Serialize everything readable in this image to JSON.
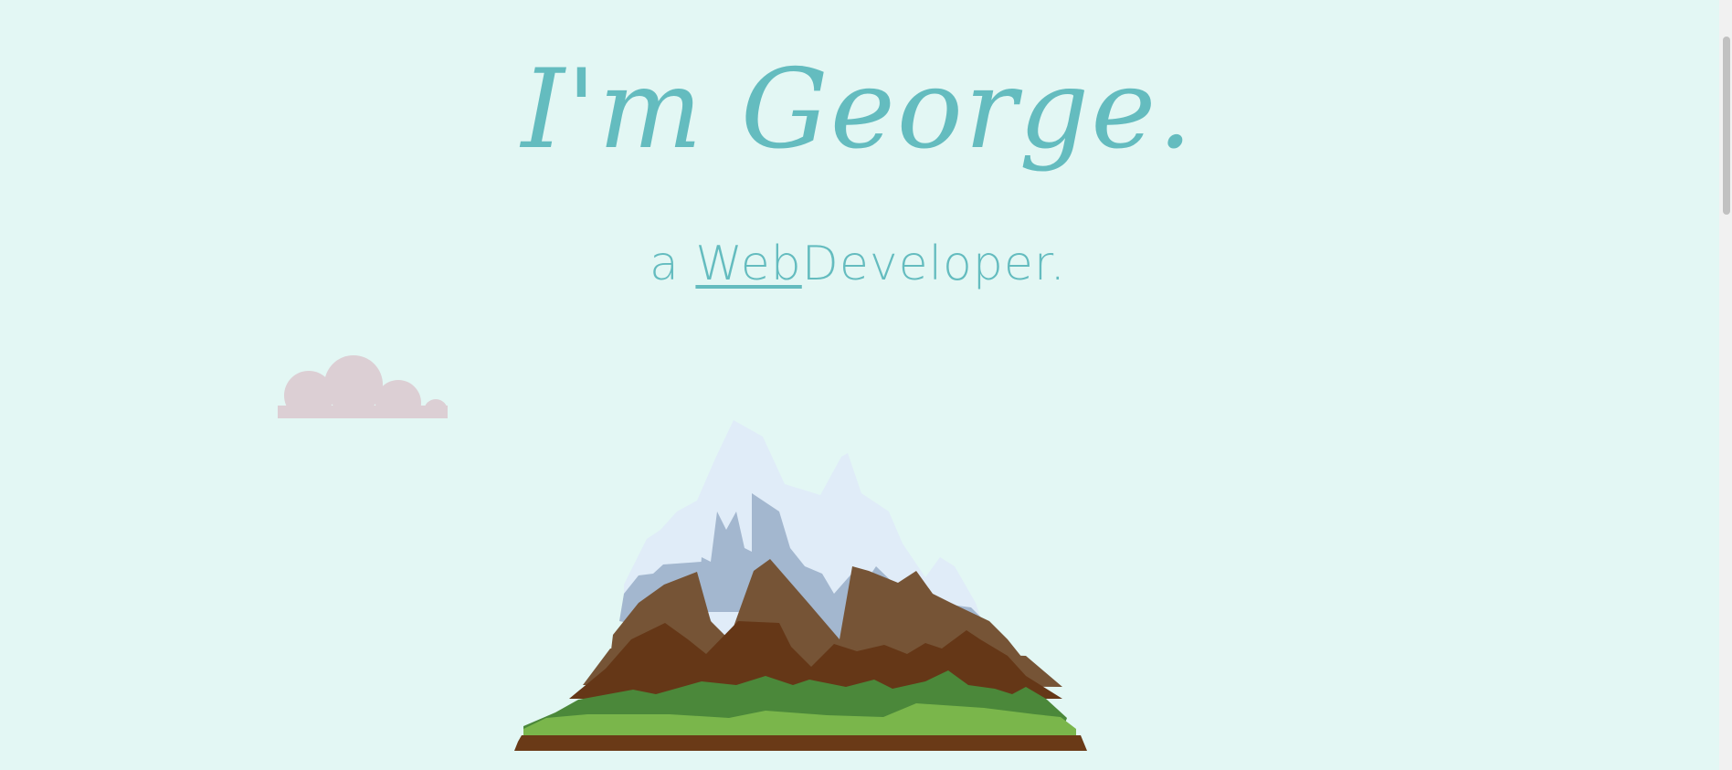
{
  "hero": {
    "title": "I'm George.",
    "subtitle_prefix": "a ",
    "subtitle_typed": "Web",
    "subtitle_suffix": "Developer."
  },
  "colors": {
    "background": "#e3f7f4",
    "accent": "#64bcbf",
    "cloud": "#dccfd4"
  },
  "illustrations": {
    "cloud": "cloud-icon",
    "mountain": "mountain-illustration"
  }
}
